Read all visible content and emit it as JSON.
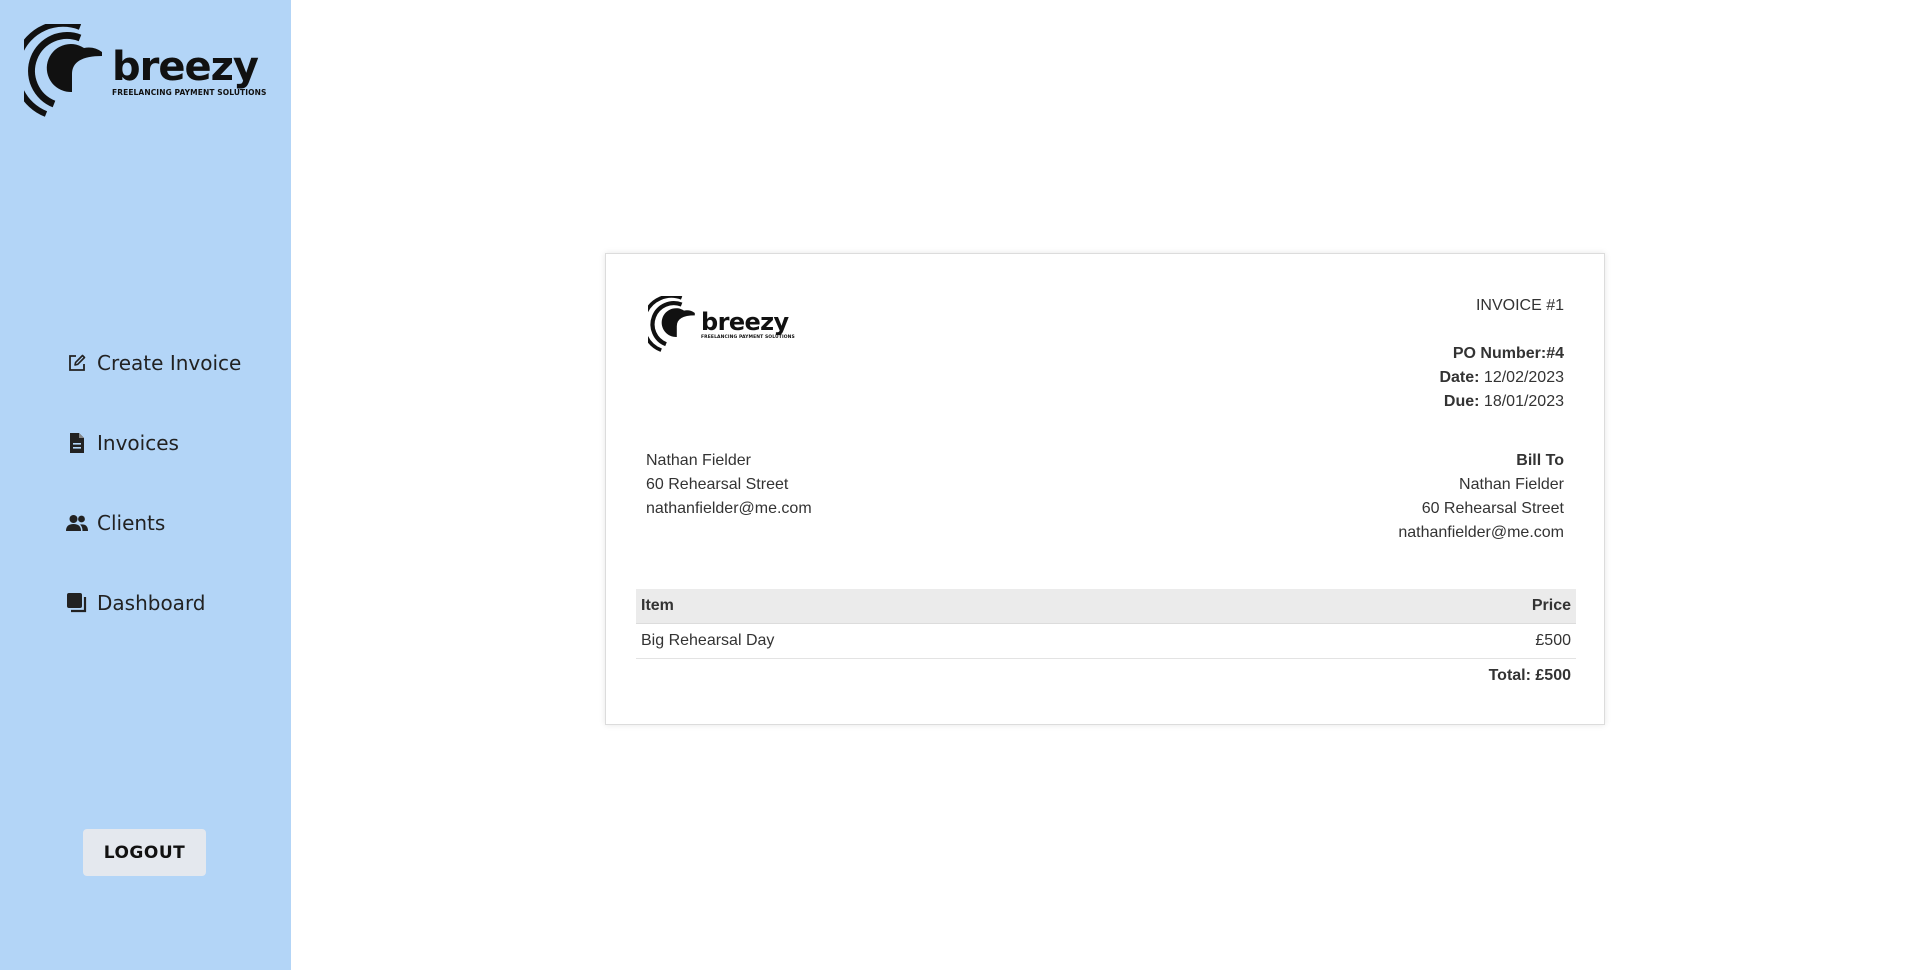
{
  "brand": {
    "name": "breezy",
    "tagline": "FREELANCING PAYMENT SOLUTIONS"
  },
  "sidebar": {
    "items": [
      {
        "label": "Create Invoice",
        "icon": "edit-icon"
      },
      {
        "label": "Invoices",
        "icon": "document-icon"
      },
      {
        "label": "Clients",
        "icon": "users-icon"
      },
      {
        "label": "Dashboard",
        "icon": "dashboard-icon"
      }
    ],
    "logout_label": "LOGOUT",
    "background": "#b3d5f7"
  },
  "invoice": {
    "number": "INVOICE #1",
    "po_label": "PO Number:",
    "po_value": "#4",
    "date_label": "Date:",
    "date_value": "12/02/2023",
    "due_label": "Due:",
    "due_value": "18/01/2023",
    "from": {
      "name": "Nathan Fielder",
      "address": "60 Rehearsal Street",
      "email": "nathanfielder@me.com"
    },
    "bill_to": {
      "heading": "Bill To",
      "name": "Nathan Fielder",
      "address": "60 Rehearsal Street",
      "email": "nathanfielder@me.com"
    },
    "table": {
      "headers": {
        "item": "Item",
        "price": "Price"
      },
      "rows": [
        {
          "item": "Big Rehearsal Day",
          "price": "£500"
        }
      ],
      "total": "Total: £500"
    }
  }
}
